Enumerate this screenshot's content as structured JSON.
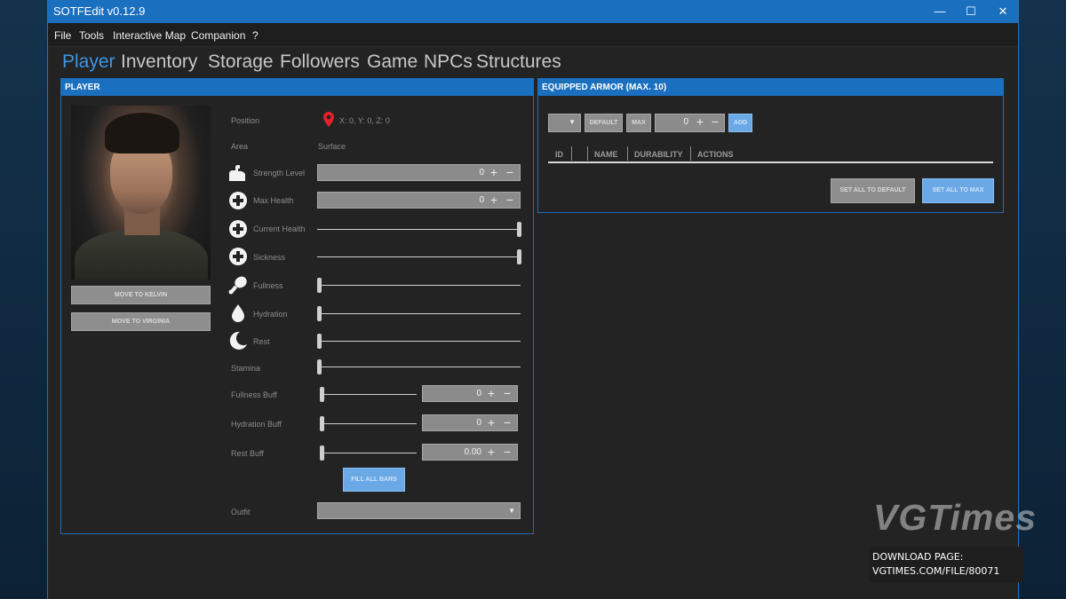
{
  "window": {
    "title": "SOTFEdit v0.12.9",
    "controls": [
      "—",
      "☐",
      "✕"
    ]
  },
  "menu": [
    "File",
    "Tools",
    "Interactive Map",
    "Companion",
    "?"
  ],
  "tabs": [
    "Player",
    "Inventory",
    "Storage",
    "Followers",
    "Game",
    "NPCs",
    "Structures"
  ],
  "active_tab": "Player",
  "player": {
    "header": "PLAYER",
    "move_kelvin": "MOVE TO KELVIN",
    "move_virginia": "MOVE TO VIRGINIA",
    "position_label": "Position",
    "position_value": "X: 0, Y: 0, Z: 0",
    "area_label": "Area",
    "area_value": "Surface",
    "strength_label": "Strength Level",
    "strength_value": "0",
    "maxhealth_label": "Max Health",
    "maxhealth_value": "0",
    "currenthealth_label": "Current Health",
    "sickness_label": "Sickness",
    "fullness_label": "Fullness",
    "hydration_label": "Hydration",
    "rest_label": "Rest",
    "stamina_label": "Stamina",
    "fullnessbuff_label": "Fullness Buff",
    "fullnessbuff_value": "0",
    "hydrationbuff_label": "Hydration Buff",
    "hydrationbuff_value": "0",
    "restbuff_label": "Rest Buff",
    "restbuff_value": "0.00",
    "fill_bars": "FILL ALL BARS",
    "outfit_label": "Outfit",
    "sliders": {
      "current_health": 1.0,
      "sickness": 1.0,
      "fullness": 0.0,
      "hydration": 0.0,
      "rest": 0.0,
      "stamina": 0.0,
      "fullness_buff": 0.0,
      "hydration_buff": 0.0,
      "rest_buff": 0.0
    }
  },
  "armor": {
    "header": "EQUIPPED ARMOR (MAX. 10)",
    "default_btn": "DEFAULT",
    "max_btn": "MAX",
    "qty_value": "0",
    "add_btn": "ADD",
    "columns": [
      "ID",
      "NAME",
      "DURABILITY",
      "ACTIONS"
    ],
    "set_default": "SET ALL TO DEFAULT",
    "set_max": "SET ALL TO MAX"
  },
  "watermark": {
    "brand": "VGTimes",
    "download_line1": "DOWNLOAD PAGE:",
    "download_line2": "VGTIMES.COM/FILE/80071"
  },
  "colors": {
    "accent": "#1a6fbf",
    "tab_active": "#3e96e4",
    "panel_bg": "#232323",
    "button_blue": "#6aa8e6"
  }
}
